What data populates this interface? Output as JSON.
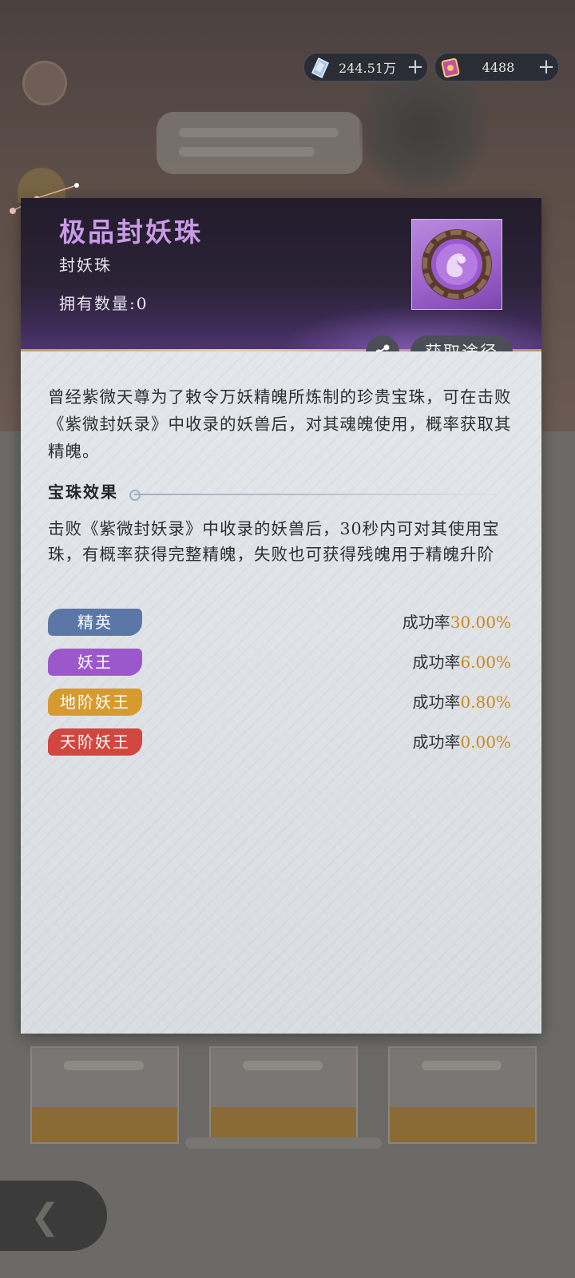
{
  "currencies": [
    {
      "icon": "spirit-crystal-icon",
      "value": "244.51万"
    },
    {
      "icon": "jade-ticket-icon",
      "value": "4488"
    }
  ],
  "item": {
    "name": "极品封妖珠",
    "type": "封妖珠",
    "owned_label": "拥有数量:0",
    "icon": "demon-sealing-orb-icon",
    "share_icon": "share-icon",
    "source_button": "获取途径",
    "description": "曾经紫微天尊为了敕令万妖精魄所炼制的珍贵宝珠，可在击败《紫微封妖录》中收录的妖兽后，对其魂魄使用，概率获取其精魄。"
  },
  "effect": {
    "title": "宝珠效果",
    "description": "击败《紫微封妖录》中收录的妖兽后，30秒内可对其使用宝珠，有概率获得完整精魄，失败也可获得残魄用于精魄升阶",
    "rate_label": "成功率",
    "tiers": [
      {
        "name": "精英",
        "rate": "30.00%",
        "color": "#5a77a8"
      },
      {
        "name": "妖王",
        "rate": "6.00%",
        "color": "#9b58cc"
      },
      {
        "name": "地阶妖王",
        "rate": "0.80%",
        "color": "#d69a2e"
      },
      {
        "name": "天阶妖王",
        "rate": "0.00%",
        "color": "#d1463f"
      }
    ]
  },
  "colors": {
    "accent_purple": "#c99ae6",
    "rate_highlight": "#c9881f"
  }
}
